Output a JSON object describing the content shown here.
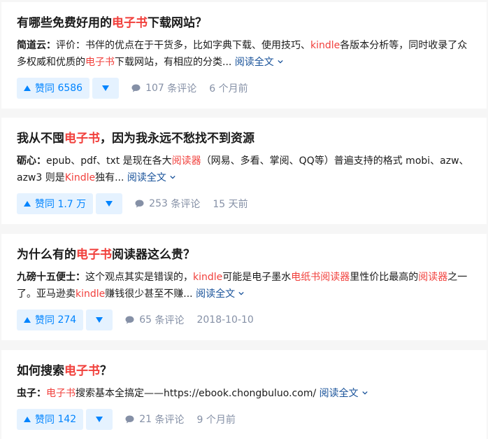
{
  "colors": {
    "highlight": "#f1403c",
    "link": "#175199",
    "vote": "#0084ff",
    "meta": "#8590a6"
  },
  "read_more_label": "阅读全文",
  "comment_suffix": "条评论",
  "vote_prefix": "赞同",
  "cards": [
    {
      "title": [
        {
          "t": "有哪些免费好用的"
        },
        {
          "t": "电子书",
          "hl": true
        },
        {
          "t": "下载网站？"
        }
      ],
      "author": "简道云",
      "excerpt": [
        {
          "t": "评价：书伴的优点在于干货多，比如字典下载、使用技巧、"
        },
        {
          "t": "kindle",
          "hl": true
        },
        {
          "t": "各版本分析等，同时收录了众多权威和优质的"
        },
        {
          "t": "电子书",
          "hl": true
        },
        {
          "t": "下载网站，有相应的分类... "
        }
      ],
      "votes": "6586",
      "comments": "107",
      "time": "6 个月前"
    },
    {
      "title": [
        {
          "t": "我从不囤"
        },
        {
          "t": "电子书",
          "hl": true
        },
        {
          "t": "，因为我永远不愁找不到资源"
        }
      ],
      "author": "砺心",
      "excerpt": [
        {
          "t": "epub、pdf、txt 是现在各大"
        },
        {
          "t": "阅读器",
          "hl": true
        },
        {
          "t": "（网易、多看、掌阅、QQ等）普遍支持的格式 mobi、azw、azw3 则是"
        },
        {
          "t": "Kindle",
          "hl": true
        },
        {
          "t": "独有... "
        }
      ],
      "votes": "1.7 万",
      "comments": "253",
      "time": "15 天前"
    },
    {
      "title": [
        {
          "t": "为什么有的"
        },
        {
          "t": "电子书",
          "hl": true
        },
        {
          "t": "阅读器这么贵？"
        }
      ],
      "author": "九磅十五便士",
      "excerpt": [
        {
          "t": "这个观点其实是错误的，"
        },
        {
          "t": "kindle",
          "hl": true
        },
        {
          "t": "可能是电子墨水"
        },
        {
          "t": "电纸书阅读器",
          "hl": true
        },
        {
          "t": "里性价比最高的"
        },
        {
          "t": "阅读器",
          "hl": true
        },
        {
          "t": "之一了。亚马逊卖"
        },
        {
          "t": "kindle",
          "hl": true
        },
        {
          "t": "赚钱很少甚至不赚... "
        }
      ],
      "votes": "274",
      "comments": "65",
      "time": "2018-10-10"
    },
    {
      "title": [
        {
          "t": "如何搜索"
        },
        {
          "t": "电子书",
          "hl": true
        },
        {
          "t": "？"
        }
      ],
      "author": "虫子",
      "excerpt": [
        {
          "t": "电子书",
          "hl": true
        },
        {
          "t": "搜索基本全搞定——https://ebook.chongbuluo.com/ "
        }
      ],
      "votes": "142",
      "comments": "21",
      "time": "9 个月前"
    }
  ]
}
